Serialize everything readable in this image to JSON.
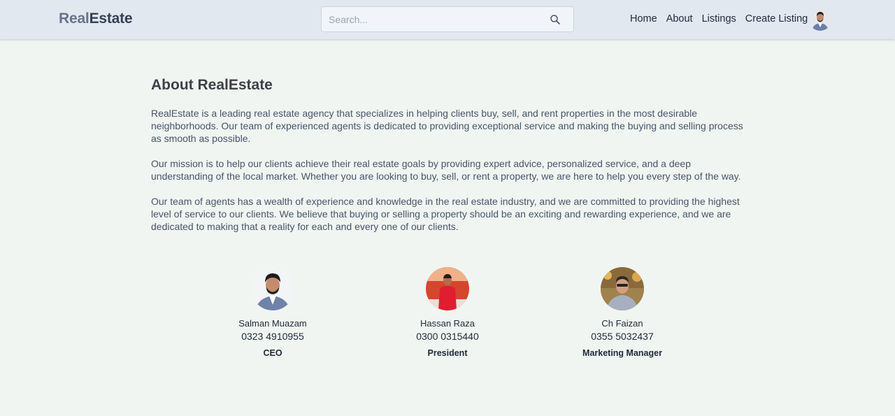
{
  "header": {
    "logo_part1": "Real",
    "logo_part2": "Estate",
    "search_placeholder": "Search...",
    "search_icon": "search-icon",
    "nav": [
      {
        "label": "Home"
      },
      {
        "label": "About"
      },
      {
        "label": "Listings"
      },
      {
        "label": "Create Listing"
      }
    ],
    "avatar_icon": "user-avatar"
  },
  "about": {
    "title": "About RealEstate",
    "paragraphs": [
      "RealEstate is a leading real estate agency that specializes in helping clients buy, sell, and rent properties in the most desirable neighborhoods. Our team of experienced agents is dedicated to providing exceptional service and making the buying and selling process as smooth as possible.",
      "Our mission is to help our clients achieve their real estate goals by providing expert advice, personalized service, and a deep understanding of the local market. Whether you are looking to buy, sell, or rent a property, we are here to help you every step of the way.",
      "Our team of agents has a wealth of experience and knowledge in the real estate industry, and we are committed to providing the highest level of service to our clients. We believe that buying or selling a property should be an exciting and rewarding experience, and we are dedicated to making that a reality for each and every one of our clients."
    ]
  },
  "team": [
    {
      "name": "Salman Muazam",
      "phone": "0323 4910955",
      "role": "CEO"
    },
    {
      "name": "Hassan Raza",
      "phone": "0300 0315440",
      "role": "President"
    },
    {
      "name": "Ch Faizan",
      "phone": "0355 5032437",
      "role": "Marketing Manager"
    }
  ],
  "colors": {
    "header_bg": "#e2e8f0",
    "page_bg": "#f1f5f1",
    "text": "#334155"
  }
}
